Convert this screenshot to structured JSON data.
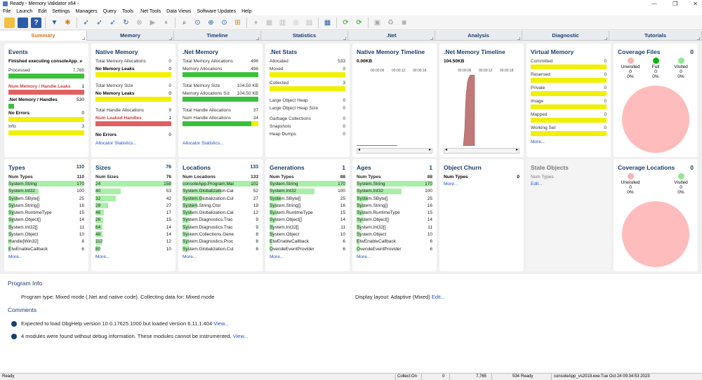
{
  "window": {
    "title": "Ready - Memory Validator x64 -"
  },
  "menu": [
    "File",
    "Launch",
    "Edit",
    "Settings",
    "Managers",
    "Query",
    "Tools",
    ".Net Tools",
    "Data Views",
    "Software Updates",
    "Help"
  ],
  "tabs": [
    "Summary",
    "Memory",
    "Timeline",
    "Statistics",
    ".Net",
    "Analysis",
    "Diagnostic",
    "Tutorials"
  ],
  "events": {
    "title": "Events",
    "status": "Finished executing consoleApp_v",
    "processed_label": "Processed",
    "processed_value": "7,765",
    "leaks_label": "Num Memory / Handle Leaks",
    "leaks_value": "1",
    "net_label": ".Net Memory / Handles",
    "net_value": "530",
    "errors_label": "No Errors",
    "errors_value": "0",
    "info_label": "Info",
    "info_value": "3"
  },
  "native_memory": {
    "title": "Native Memory",
    "total_alloc_label": "Total Memory Allocations",
    "total_alloc_value": "0",
    "no_leaks_label": "No Memory Leaks",
    "no_leaks_value": "0",
    "total_size_label": "Total Memory Size",
    "total_size_value": "0",
    "no_leaks2_label": "No Memory Leaks",
    "no_leaks2_value": "0",
    "total_handle_label": "Total Handle Allocations",
    "total_handle_value": "9",
    "leaked_handles_label": "Num Leaked Handles",
    "leaked_handles_value": "1",
    "no_errors_label": "No Errors",
    "no_errors_value": "0",
    "link": "Allocator Statistics..."
  },
  "net_memory": {
    "title": ".Net Memory",
    "total_alloc_label": "Total Memory Allocations",
    "total_alloc_value": "496",
    "mem_alloc_label": "Memory Allocations",
    "mem_alloc_value": "496",
    "total_size_label": "Total Memory Size",
    "total_size_value": "104.50 KB",
    "alloc_size_label": "Memory Allocations Siz",
    "alloc_size_value": "104.50 KB",
    "total_handle_label": "Total Handle Allocations",
    "total_handle_value": "37",
    "num_handle_label": "Num Handle Allocations",
    "num_handle_value": "34",
    "link": "Allocator Statistics..."
  },
  "net_stats": {
    "title": ".Net Stats",
    "rows": [
      {
        "label": "Allocated",
        "value": "533"
      },
      {
        "label": "Moved",
        "value": "0"
      },
      {
        "label": "Collected",
        "value": "3"
      },
      {
        "label": "Large Object Heap",
        "value": "0"
      },
      {
        "label": "Large Object Heap Size",
        "value": "0"
      },
      {
        "label": "Garbage Collections",
        "value": "0"
      },
      {
        "label": "Snapshots",
        "value": "0"
      },
      {
        "label": "Heap Dumps",
        "value": "0"
      }
    ]
  },
  "native_timeline": {
    "title": "Native Memory Timeline",
    "value": "0.00KB",
    "ticks": [
      "00:00:06",
      "00:00:12",
      "00:00:18"
    ]
  },
  "net_timeline": {
    "title": ".Net Memory Timeline",
    "value": "104.50KB",
    "ticks": [
      "00:00:06",
      "00:00:12",
      "00:00:18"
    ]
  },
  "virtual_memory": {
    "title": "Virtual Memory",
    "rows": [
      {
        "label": "Committed",
        "value": "0"
      },
      {
        "label": "Reserved",
        "value": "0"
      },
      {
        "label": "Private",
        "value": "0"
      },
      {
        "label": "Image",
        "value": "0"
      },
      {
        "label": "Mapped",
        "value": "0"
      },
      {
        "label": "Working Set",
        "value": "0"
      }
    ],
    "link": "More..."
  },
  "coverage_files": {
    "title": "Coverage Files",
    "count": "0",
    "legend": [
      {
        "label": "Unvisited",
        "count": "0",
        "pct": "0%",
        "color": "#f5b5b5"
      },
      {
        "label": "Full",
        "count": "0",
        "pct": "0%",
        "color": "#10b010"
      },
      {
        "label": "Visited",
        "count": "0",
        "pct": "0%",
        "color": "#90e890"
      }
    ],
    "pie_color": "#ffbcbc"
  },
  "types": {
    "title": "Types",
    "count": "110",
    "head": {
      "label": "Num Types",
      "value": "110"
    },
    "rows": [
      {
        "label": "System.String",
        "value": "170"
      },
      {
        "label": "System.Int32",
        "value": "100"
      },
      {
        "label": "System.SByte[]",
        "value": "25"
      },
      {
        "label": "System.String[]",
        "value": "16"
      },
      {
        "label": "System.RuntimeType",
        "value": "15"
      },
      {
        "label": "System.Object[]",
        "value": "14"
      },
      {
        "label": "System.Int32[]",
        "value": "11"
      },
      {
        "label": "System.Object",
        "value": "10"
      },
      {
        "label": "Handle[Win32]",
        "value": "8"
      },
      {
        "label": "EtwEnableCallback",
        "value": "6"
      }
    ],
    "link": "More..."
  },
  "sizes": {
    "title": "Sizes",
    "count": "76",
    "head": {
      "label": "Num Sizes",
      "value": "76"
    },
    "rows": [
      {
        "label": "24",
        "value": "158"
      },
      {
        "label": "40",
        "value": "53"
      },
      {
        "label": "32",
        "value": "42"
      },
      {
        "label": "28",
        "value": "27"
      },
      {
        "label": "46",
        "value": "17"
      },
      {
        "label": "26",
        "value": "15"
      },
      {
        "label": "64",
        "value": "14"
      },
      {
        "label": "48",
        "value": "14"
      },
      {
        "label": "112",
        "value": "12"
      },
      {
        "label": "80",
        "value": "10"
      }
    ],
    "link": "More..."
  },
  "locations": {
    "title": "Locations",
    "count": "133",
    "head": {
      "label": "Num Locations",
      "value": "133"
    },
    "rows": [
      {
        "label": "consoleApp.Program.Mai",
        "value": "102"
      },
      {
        "label": "System.Globalization.Cal",
        "value": "52"
      },
      {
        "label": "System.Globalization.Cul",
        "value": "27"
      },
      {
        "label": "System.String.Ctor",
        "value": "19"
      },
      {
        "label": "System.Globalization.Cal",
        "value": "12"
      },
      {
        "label": "System.Diagnostics.Trac",
        "value": "9"
      },
      {
        "label": "System.Diagnostics.Trac",
        "value": "9"
      },
      {
        "label": "System.Collections.Gene",
        "value": "8"
      },
      {
        "label": "System.Diagnostics.Proc",
        "value": "8"
      },
      {
        "label": "System.Globalization.Cul",
        "value": "8"
      }
    ],
    "link": "More..."
  },
  "generations": {
    "title": "Generations",
    "count": "1",
    "head": {
      "label": "Num Types",
      "value": "88"
    },
    "rows": [
      {
        "label": "System.String",
        "value": "170"
      },
      {
        "label": "System.Int32",
        "value": "100"
      },
      {
        "label": "System.SByte[]",
        "value": "25"
      },
      {
        "label": "System.String[]",
        "value": "16"
      },
      {
        "label": "System.RuntimeType",
        "value": "15"
      },
      {
        "label": "System.Object[]",
        "value": "14"
      },
      {
        "label": "System.Int32[]",
        "value": "11"
      },
      {
        "label": "System.Object",
        "value": "10"
      },
      {
        "label": "EtwEnableCallback",
        "value": "6"
      },
      {
        "label": "OverideEventProvider",
        "value": "6"
      }
    ],
    "link": "More..."
  },
  "ages": {
    "title": "Ages",
    "count": "1",
    "head": {
      "label": "Num Types",
      "value": "88"
    },
    "rows": [
      {
        "label": "System.String",
        "value": "170"
      },
      {
        "label": "System.Int32",
        "value": "100"
      },
      {
        "label": "System.SByte[]",
        "value": "25"
      },
      {
        "label": "System.String[]",
        "value": "16"
      },
      {
        "label": "System.RuntimeType",
        "value": "15"
      },
      {
        "label": "System.Object[]",
        "value": "14"
      },
      {
        "label": "System.Int32[]",
        "value": "11"
      },
      {
        "label": "System.Object",
        "value": "10"
      },
      {
        "label": "EtwEnableCallback",
        "value": "6"
      },
      {
        "label": "OverideEventProvider",
        "value": "6"
      }
    ],
    "link": "More..."
  },
  "object_churn": {
    "title": "Object Churn",
    "head_label": "Num Types",
    "head_value": "0",
    "link": "More..."
  },
  "stale_objects": {
    "title": "Stale Objects",
    "head_label": "Num Types",
    "link": "Edit..."
  },
  "coverage_locations": {
    "title": "Coverage Locations",
    "count": "0",
    "legend": [
      {
        "label": "Unvisited",
        "count": "0",
        "pct": "0%",
        "color": "#f5b5b5"
      },
      {
        "label": "Visited",
        "count": "0",
        "pct": "0%",
        "color": "#90e890"
      }
    ]
  },
  "program_info": {
    "title": "Program Info",
    "program_type": "Program type: Mixed mode (.Net and native code). Collecting data for: Mixed mode",
    "display_layout": "Display layout: Adaptive (Mixed)",
    "edit_link": "Edit..."
  },
  "comments": {
    "title": "Comments",
    "items": [
      {
        "text": "Expected to load DbgHelp version 10.0.17625.1000 but loaded version 6.11.1.404",
        "link": "View..."
      },
      {
        "text": "4 modules were found without debug information. These modules cannot be instrumented.",
        "link": "View..."
      }
    ]
  },
  "status": {
    "ready": "Ready",
    "collect": "Collect:On",
    "v1": "0",
    "v2": "7,765",
    "v3": "534",
    "ready2": "Ready",
    "file": "consoleApp_vs2019.exe:Tue Oct 24 09:34:53 2023"
  }
}
